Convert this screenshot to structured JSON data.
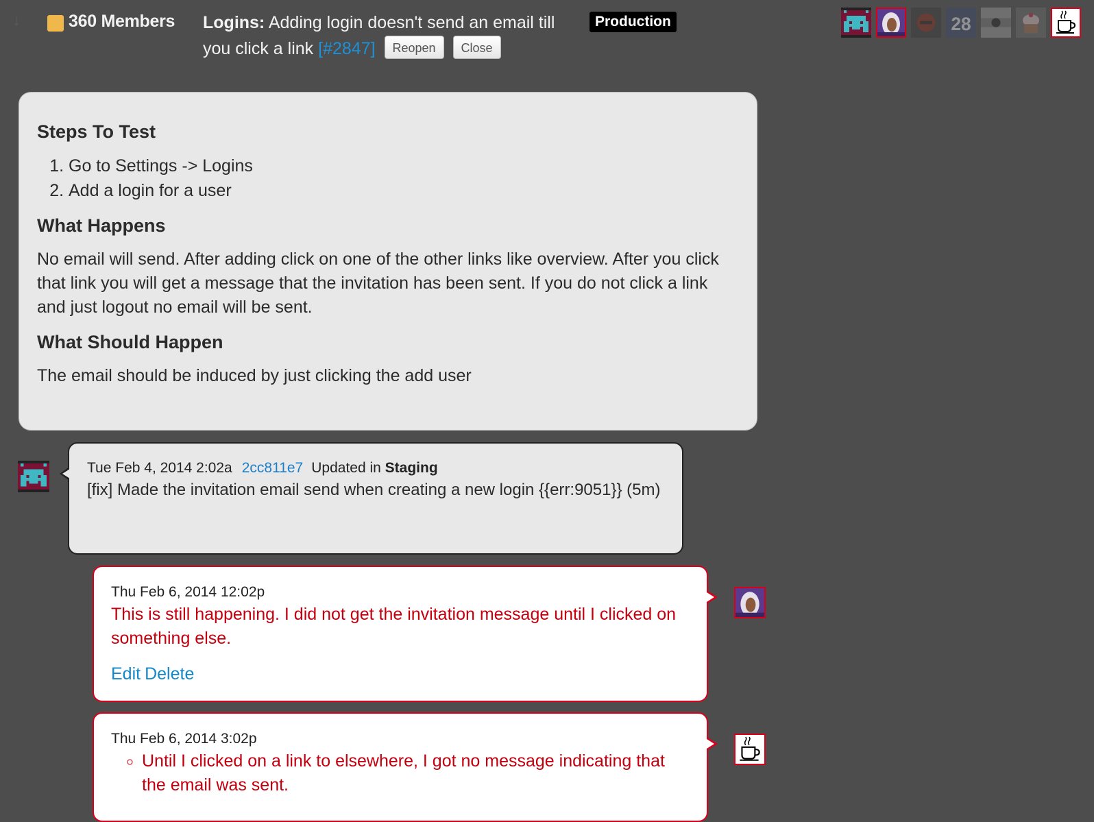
{
  "header": {
    "project_color": "#f0b84a",
    "project_name": "360 Members",
    "category": "Logins:",
    "title_text": "Adding login doesn't send an email till you click a link",
    "issue_number": "[#2847]",
    "reopen_label": "Reopen",
    "close_label": "Close",
    "environment_badge": "Production"
  },
  "header_avatars": [
    {
      "name": "pixel-invader-avatar",
      "active": false
    },
    {
      "name": "hooded-figure-avatar",
      "active": true
    },
    {
      "name": "red-helmet-avatar",
      "active": false
    },
    {
      "name": "number-28-avatar",
      "active": false
    },
    {
      "name": "gray-emblem-avatar",
      "active": false
    },
    {
      "name": "cupcake-avatar",
      "active": false
    },
    {
      "name": "coffee-cup-avatar",
      "active": true
    }
  ],
  "description": {
    "steps_heading": "Steps To Test",
    "steps": [
      "Go to Settings -> Logins",
      "Add a login for a user"
    ],
    "happens_heading": "What Happens",
    "happens_text": "No email will send. After adding click on one of the other links like overview. After you click that link you will get a message that the invitation has been sent. If you do not click a link and just logout no email will be sent.",
    "should_heading": "What Should Happen",
    "should_text": "The email should be induced by just clicking the add user"
  },
  "commit": {
    "date": "Tue Feb 4, 2014 2:02a",
    "hash": "2cc811e7",
    "updated_prefix": "Updated in",
    "environment": "Staging",
    "message": "[fix] Made the invitation email send when creating a new login {{err:9051}} (5m)"
  },
  "comments": [
    {
      "date": "Thu Feb 6, 2014 12:02p",
      "text": "This is still happening. I did not get the invitation message until I clicked on something else.",
      "edit_label": "Edit",
      "delete_label": "Delete"
    },
    {
      "date": "Thu Feb 6, 2014 3:02p",
      "bullets": [
        "Until I clicked on a link to elsewhere, I got no message indicating that the email was sent."
      ]
    }
  ],
  "colors": {
    "background": "#4d4d4d",
    "accent_red": "#d9001b",
    "link_blue": "#1488c8"
  }
}
